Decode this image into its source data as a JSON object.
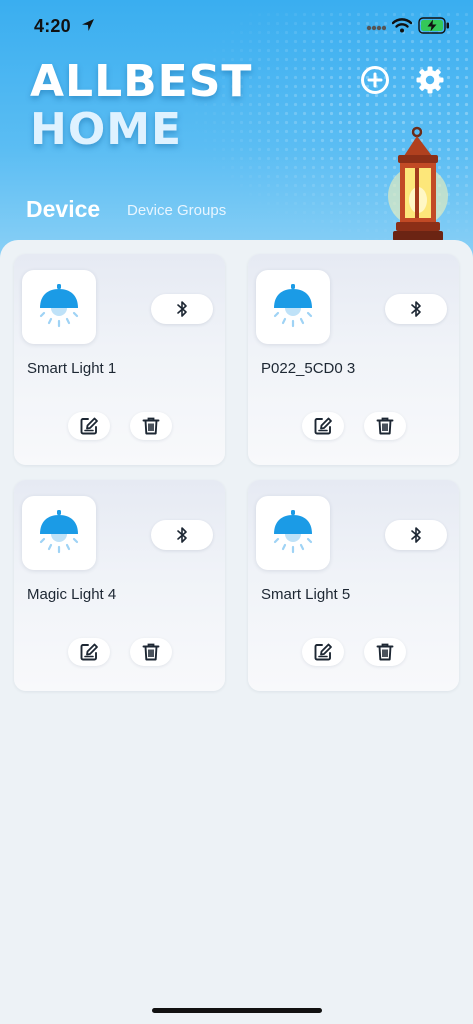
{
  "status_bar": {
    "time": "4:20"
  },
  "header": {
    "brand_line1": "ALLBEST",
    "brand_line2": "HOME",
    "accent_color": "#3aaef0"
  },
  "tabs": [
    {
      "label": "Device",
      "active": true
    },
    {
      "label": "Device Groups",
      "active": false
    }
  ],
  "devices": [
    {
      "name": "Smart Light 1",
      "icon": "bulb-icon"
    },
    {
      "name": "P022_5CD0 3",
      "icon": "bulb-icon"
    },
    {
      "name": "Magic Light 4",
      "icon": "bulb-icon"
    },
    {
      "name": "Smart Light 5",
      "icon": "bulb-icon"
    }
  ],
  "colors": {
    "bulb": "#1b9be6",
    "bulb_glow": "#bfe2f8",
    "page_bg": "#edf2f6"
  }
}
